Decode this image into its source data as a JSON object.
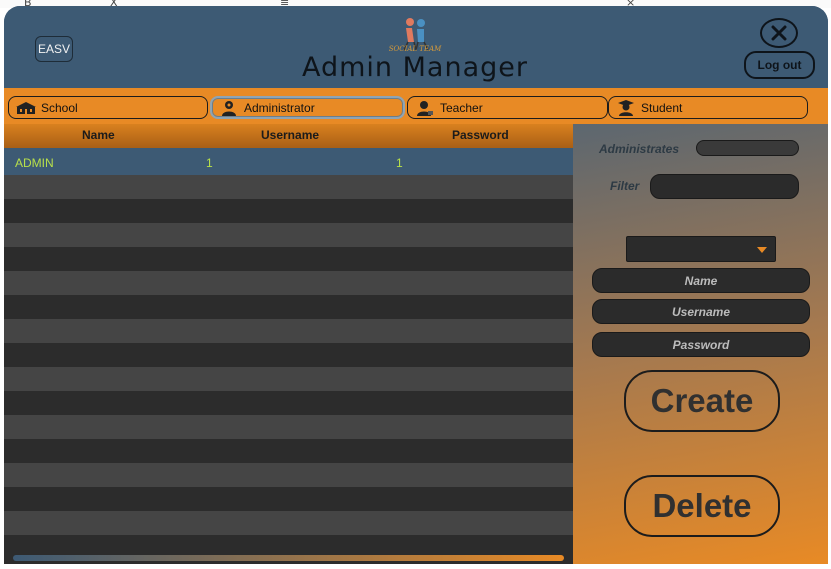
{
  "header": {
    "easv_label": "EASV",
    "logo_text": "SOCIAL TEAM",
    "title": "Admin Manager",
    "logout_label": "Log out"
  },
  "tabs": [
    {
      "label": "School",
      "icon": "school-icon"
    },
    {
      "label": "Administrator",
      "icon": "administrator-icon",
      "selected": true
    },
    {
      "label": "Teacher",
      "icon": "teacher-icon"
    },
    {
      "label": "Student",
      "icon": "student-icon"
    }
  ],
  "table": {
    "columns": [
      "Name",
      "Username",
      "Password"
    ],
    "rows": [
      {
        "name": "ADMIN",
        "username": "1",
        "password": "1"
      }
    ]
  },
  "side_panel": {
    "administrates_label": "Administrates",
    "filter_label": "Filter",
    "name_placeholder": "Name",
    "username_placeholder": "Username",
    "password_placeholder": "Password",
    "create_label": "Create",
    "delete_label": "Delete"
  },
  "colors": {
    "header_bg": "#3d5a74",
    "accent_orange": "#e88a25",
    "row_dark": "#2c2c2c",
    "row_light": "#454545",
    "row_text": "#b8e04a"
  }
}
